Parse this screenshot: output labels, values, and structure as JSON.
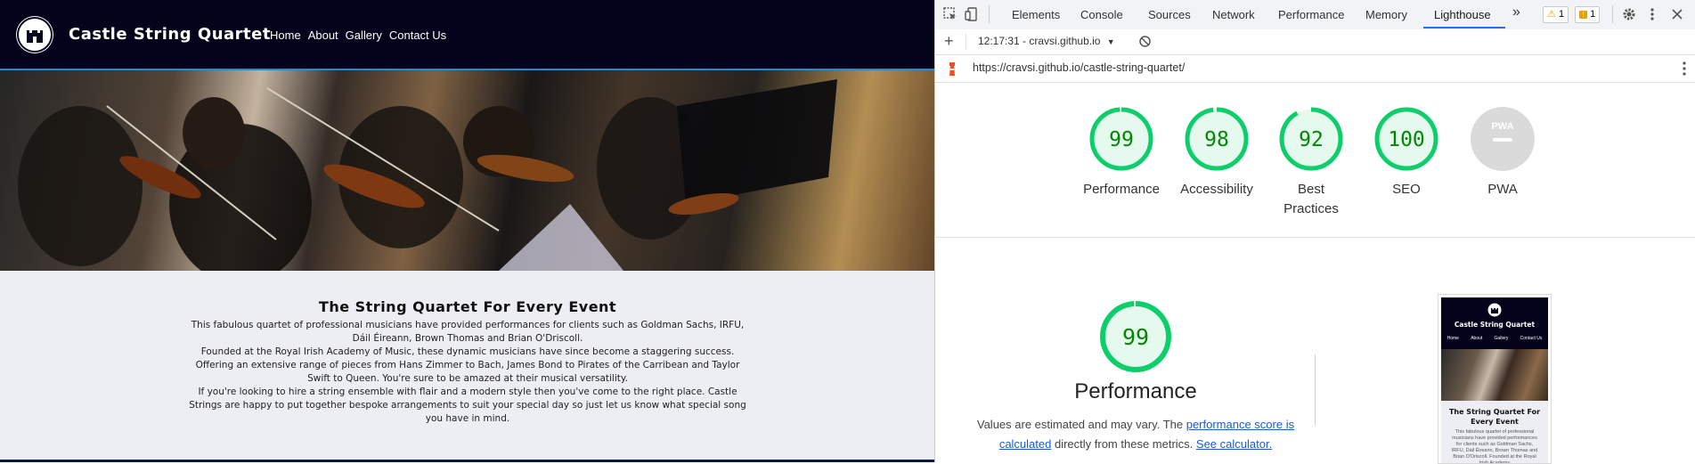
{
  "site": {
    "brand": "Castle String Quartet",
    "nav": [
      "Home",
      "About",
      "Gallery",
      "Contact Us"
    ],
    "intro_title": "The String Quartet For Every Event",
    "paragraphs": [
      "This fabulous quartet of professional musicians have provided performances for clients such as Goldman Sachs, IRFU, Dáil Éireann, Brown Thomas and Brian O'Driscoll.",
      "Founded at the Royal Irish Academy of Music, these dynamic musicians have since become a staggering success.",
      "Offering an extensive range of pieces from Hans Zimmer to Bach, James Bond to Pirates of the Carribean and Taylor Swift to Queen. You're sure to be amazed at their musical versatility.",
      "If you're looking to hire a string ensemble with flair and a modern style then you've come to the right place. Castle Strings are happy to put together bespoke arrangements to suit your special day so just let us know what special song you have in mind."
    ]
  },
  "devtools": {
    "tabs": [
      "Elements",
      "Console",
      "Sources",
      "Network",
      "Performance",
      "Memory",
      "Lighthouse"
    ],
    "active_tab": "Lighthouse",
    "more_tabs_icon": "»",
    "warnings_count": "1",
    "issues_count": "1",
    "report_selector": "12:17:31 - cravsi.github.io",
    "url": "https://cravsi.github.io/castle-string-quartet/",
    "scores": [
      {
        "label": "Performance",
        "value": 99
      },
      {
        "label": "Accessibility",
        "value": 98
      },
      {
        "label": "Best Practices",
        "value": 92
      },
      {
        "label": "SEO",
        "value": 100
      },
      {
        "label": "PWA",
        "value": null
      }
    ],
    "pwa_badge_text": "PWA",
    "detail": {
      "score": 99,
      "title": "Performance",
      "desc_prefix": "Values are estimated and may vary. The ",
      "desc_link1": "performance score is calculated",
      "desc_middle": " directly from these metrics. ",
      "desc_link2": "See calculator."
    },
    "thumbnail": {
      "brand": "Castle String Quartet",
      "nav": [
        "Home",
        "About",
        "Gallery",
        "Contact Us"
      ],
      "title": "The String Quartet For Every Event",
      "text": "This fabulous quartet of professional musicians have provided performances for clients such as Goldman Sachs, IRFU, Dáil Éireann, Brown Thomas and Brian O'Driscoll. Founded at the Royal Irish Academy"
    },
    "colors": {
      "pass": "#0cce6b",
      "pass_bg": "#e6f9ee",
      "pass_text": "#008800",
      "pwa_gray": "#dadada"
    }
  }
}
